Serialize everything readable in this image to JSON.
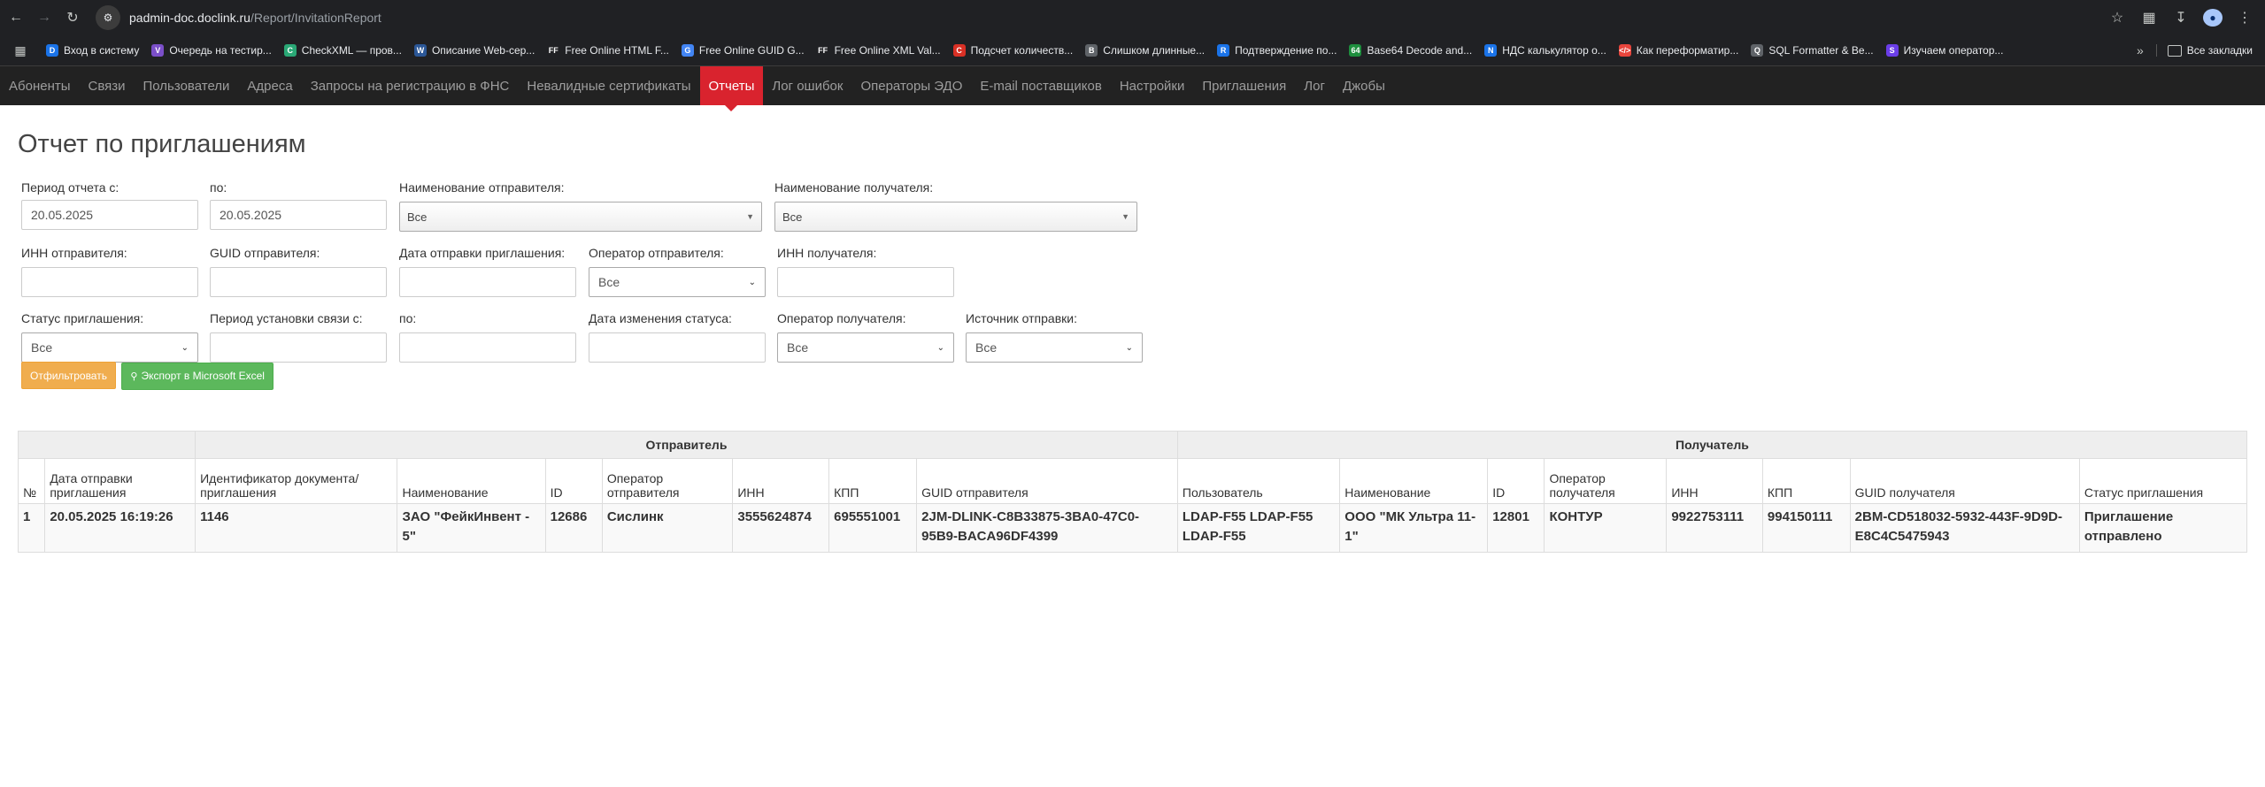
{
  "browser": {
    "url_host": "padmin-doc.doclink.ru",
    "url_path": "/Report/InvitationReport",
    "bookmarks": [
      {
        "label": "Вход в систему",
        "icon": "doclink-icon",
        "color": "#1a73e8",
        "glyph": "D"
      },
      {
        "label": "Очередь на тестир...",
        "icon": "visualstudio-icon",
        "color": "#7b4fc9",
        "glyph": "V"
      },
      {
        "label": "CheckXML — пров...",
        "icon": "checkxml-icon",
        "color": "#2aa876",
        "glyph": "C"
      },
      {
        "label": "Описание Web-сер...",
        "icon": "web-service-icon",
        "color": "#2b5797",
        "glyph": "W"
      },
      {
        "label": "Free Online HTML F...",
        "icon": "freeformatter-icon",
        "color": "#202124",
        "glyph": "FF"
      },
      {
        "label": "Free Online GUID G...",
        "icon": "guid-generator-icon",
        "color": "#4285f4",
        "glyph": "G"
      },
      {
        "label": "Free Online XML Val...",
        "icon": "freeformatter-icon",
        "color": "#202124",
        "glyph": "FF"
      },
      {
        "label": "Подсчет количеств...",
        "icon": "counter-icon",
        "color": "#d93025",
        "glyph": "C"
      },
      {
        "label": "Слишком длинные...",
        "icon": "book-icon",
        "color": "#5f6368",
        "glyph": "B"
      },
      {
        "label": "Подтверждение по...",
        "icon": "russia-flag-icon",
        "color": "#1a73e8",
        "glyph": "R"
      },
      {
        "label": "Base64 Decode and...",
        "icon": "base64-icon",
        "color": "#1e8e3e",
        "glyph": "64"
      },
      {
        "label": "НДС калькулятор о...",
        "icon": "calculator-icon",
        "color": "#1a73e8",
        "glyph": "N"
      },
      {
        "label": "Как переформатир...",
        "icon": "code-icon",
        "color": "#e8453c",
        "glyph": "</>"
      },
      {
        "label": "SQL Formatter & Be...",
        "icon": "sql-icon",
        "color": "#5f6368",
        "glyph": "Q"
      },
      {
        "label": "Изучаем оператор...",
        "icon": "learn-icon",
        "color": "#6a3de8",
        "glyph": "S"
      }
    ],
    "all_bookmarks": "Все закладки"
  },
  "nav": {
    "items": [
      "Абоненты",
      "Связи",
      "Пользователи",
      "Адреса",
      "Запросы на регистрацию в ФНС",
      "Невалидные сертификаты",
      "Отчеты",
      "Лог ошибок",
      "Операторы ЭДО",
      "E-mail поставщиков",
      "Настройки",
      "Приглашения",
      "Лог",
      "Джобы"
    ],
    "active": "Отчеты"
  },
  "page": {
    "title": "Отчет по приглашениям"
  },
  "filters": {
    "period_from_label": "Период отчета с:",
    "period_from_value": "20.05.2025",
    "period_to_label": "по:",
    "period_to_value": "20.05.2025",
    "sender_name_label": "Наименование отправителя:",
    "sender_name_value": "Все",
    "recipient_name_label": "Наименование получателя:",
    "recipient_name_value": "Все",
    "sender_inn_label": "ИНН отправителя:",
    "sender_guid_label": "GUID отправителя:",
    "invite_date_label": "Дата отправки приглашения:",
    "sender_operator_label": "Оператор отправителя:",
    "sender_operator_value": "Все",
    "recipient_inn_label": "ИНН получателя:",
    "invite_status_label": "Статус приглашения:",
    "invite_status_value": "Все",
    "link_period_from_label": "Период установки связи с:",
    "link_period_to_label": "по:",
    "status_change_date_label": "Дата изменения статуса:",
    "recipient_operator_label": "Оператор получателя:",
    "recipient_operator_value": "Все",
    "source_label": "Источник отправки:",
    "source_value": "Все"
  },
  "buttons": {
    "filter": "Отфильтровать",
    "export": "Экспорт в Microsoft Excel"
  },
  "table": {
    "group_sender": "Отправитель",
    "group_recipient": "Получатель",
    "columns": [
      "№",
      "Дата отправки приглашения",
      "Идентификатор документа/приглашения",
      "Наименование",
      "ID",
      "Оператор отправителя",
      "ИНН",
      "КПП",
      "GUID отправителя",
      "Пользователь",
      "Наименование",
      "ID",
      "Оператор получателя",
      "ИНН",
      "КПП",
      "GUID получателя",
      "Статус приглашения"
    ],
    "rows": [
      [
        "1",
        "20.05.2025 16:19:26",
        "1146",
        "ЗАО \"ФейкИнвент - 5\"",
        "12686",
        "Сислинк",
        "3555624874",
        "695551001",
        "2JM-DLINK-C8B33875-3BA0-47C0-95B9-BACA96DF4399",
        "LDAP-F55 LDAP-F55 LDAP-F55",
        "ООО \"МК Ультра 11-1\"",
        "12801",
        "КОНТУР",
        "9922753111",
        "994150111",
        "2BM-CD518032-5932-443F-9D9D-E8C4C5475943",
        "Приглашение отправлено"
      ]
    ]
  }
}
